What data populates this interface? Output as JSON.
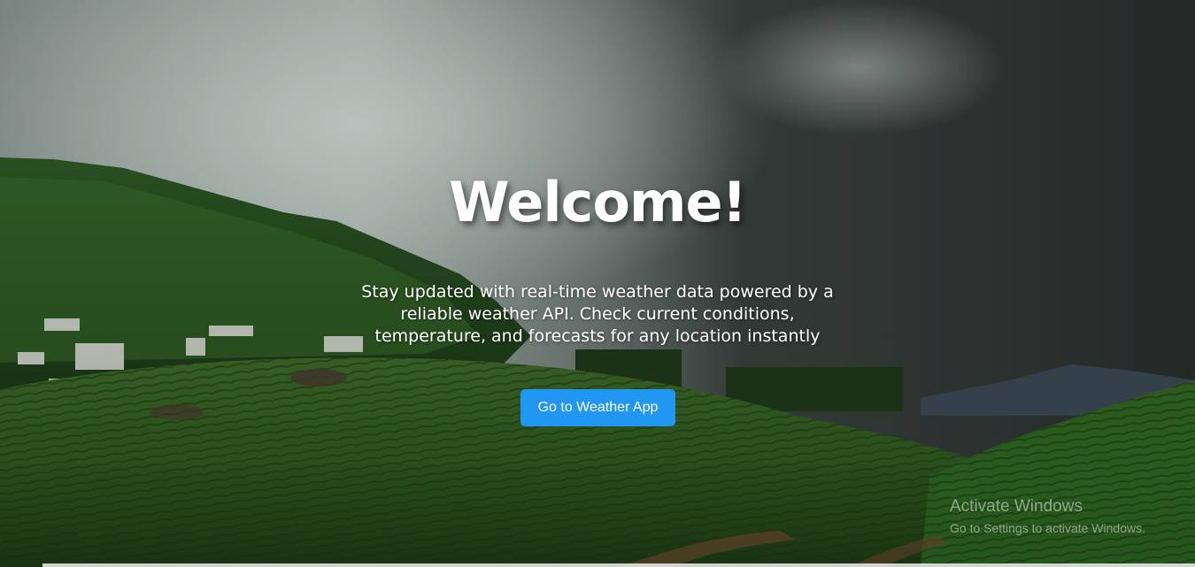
{
  "hero": {
    "title": "Welcome!",
    "description": "Stay updated with real-time weather data powered by a reliable weather API. Check current conditions, temperature, and forecasts for any location instantly",
    "button_label": "Go to Weather App"
  },
  "watermark": {
    "title": "Activate Windows",
    "subtitle": "Go to Settings to activate Windows."
  },
  "colors": {
    "button": "#2196f3",
    "text": "#ffffff"
  }
}
